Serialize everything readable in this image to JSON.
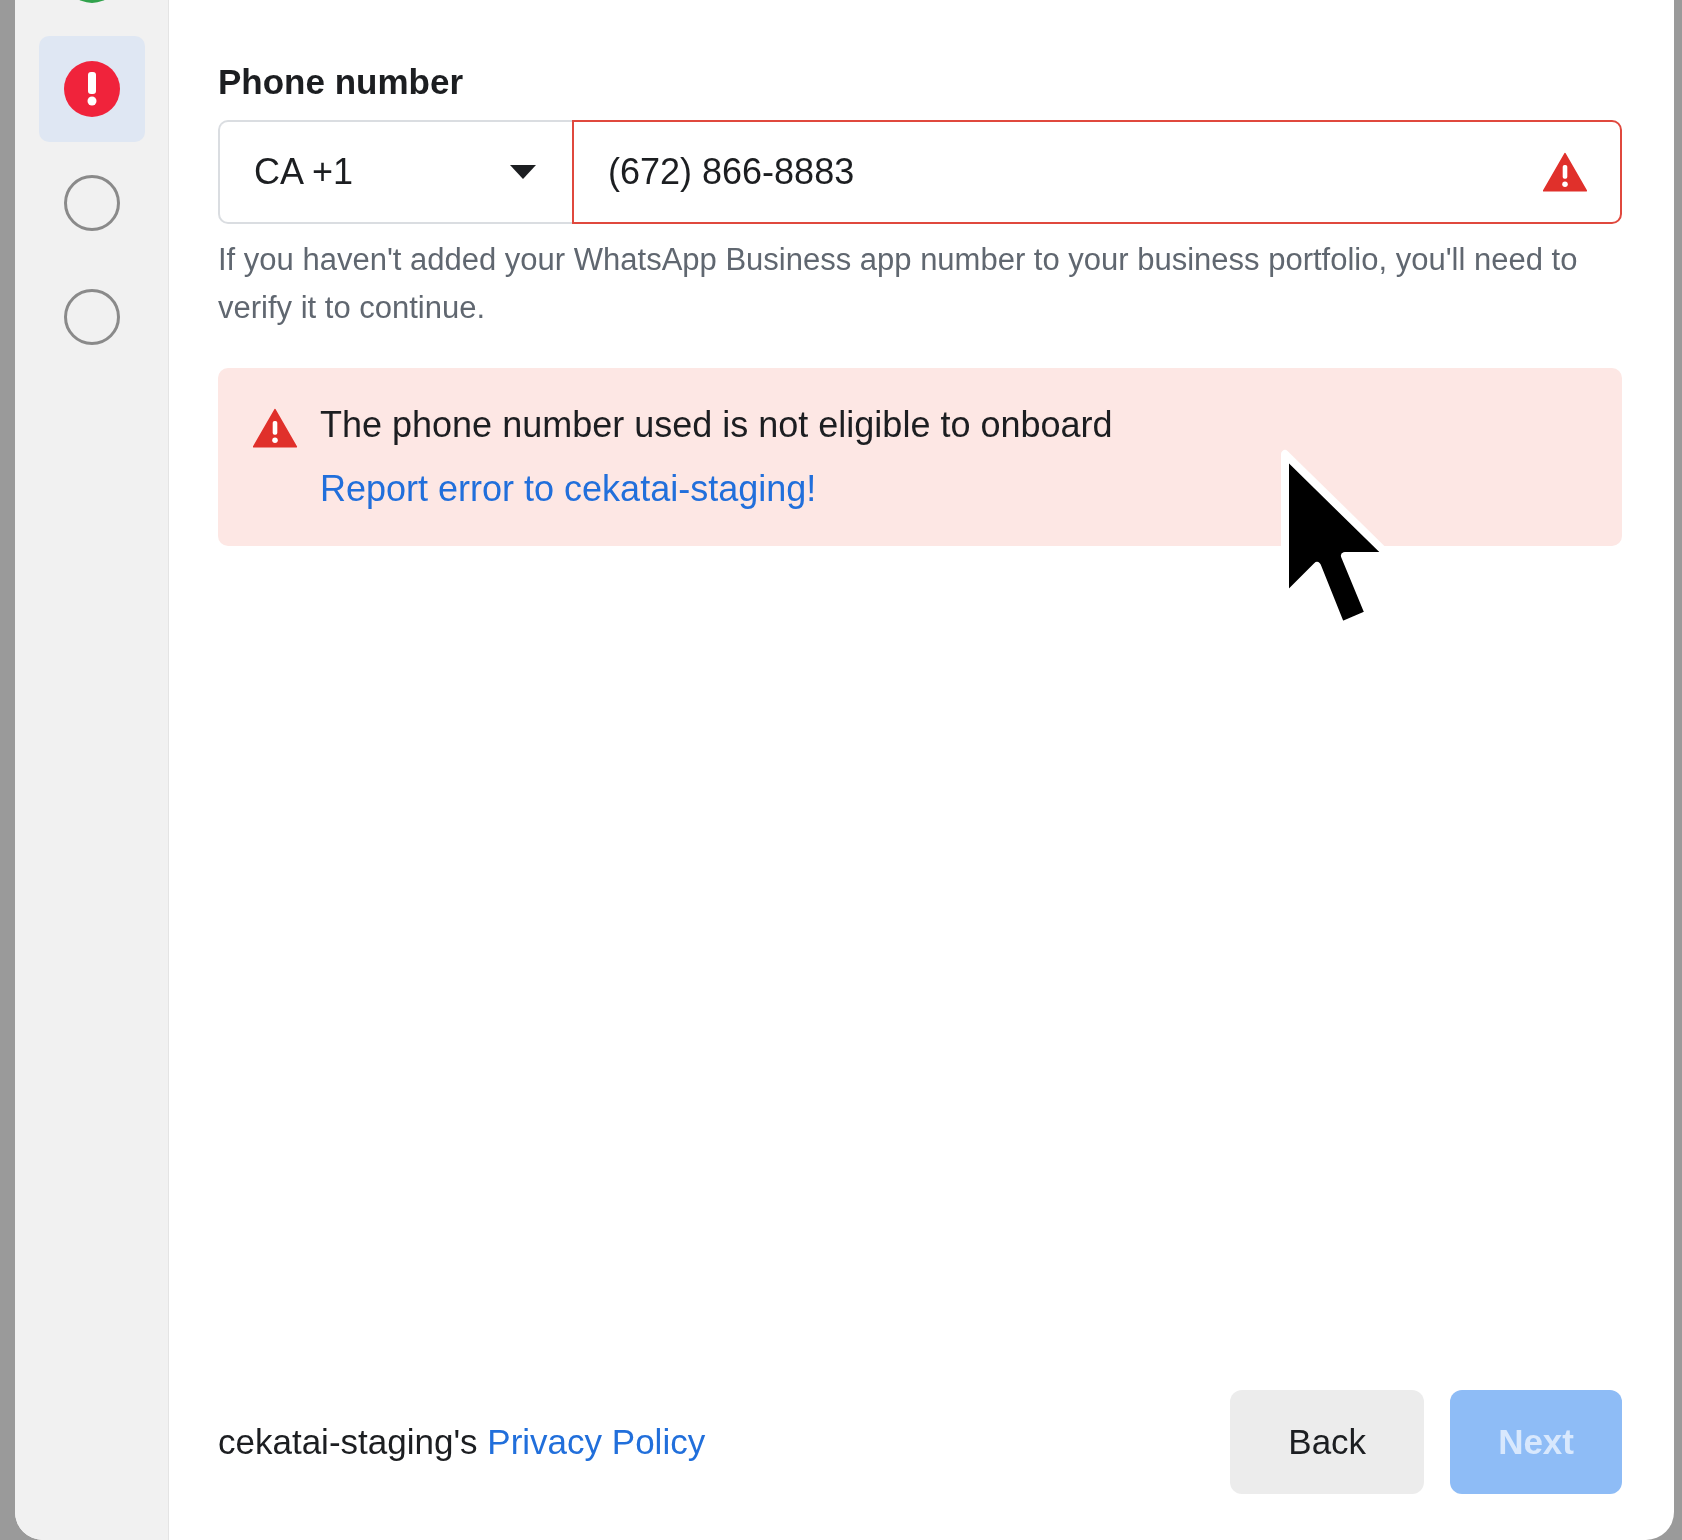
{
  "steps": [
    {
      "kind": "done",
      "selected": false
    },
    {
      "kind": "error",
      "selected": true
    },
    {
      "kind": "pending",
      "selected": false
    },
    {
      "kind": "pending",
      "selected": false
    }
  ],
  "phone": {
    "label": "Phone number",
    "country": "CA +1",
    "value": "(672) 866-8883",
    "invalid": true,
    "helper": "If you haven't added your WhatsApp Business app number to your business portfolio, you'll need to verify it to continue."
  },
  "error_banner": {
    "message": "The phone number used is not eligible to onboard",
    "link": "Report error to cekatai-staging!"
  },
  "footer": {
    "policy_prefix": "cekatai-staging's",
    "policy_link": "Privacy Policy",
    "buttons": [
      {
        "label": "Back",
        "kind": "secondary",
        "disabled": false
      },
      {
        "label": "Next",
        "kind": "primary",
        "disabled": true
      }
    ]
  }
}
